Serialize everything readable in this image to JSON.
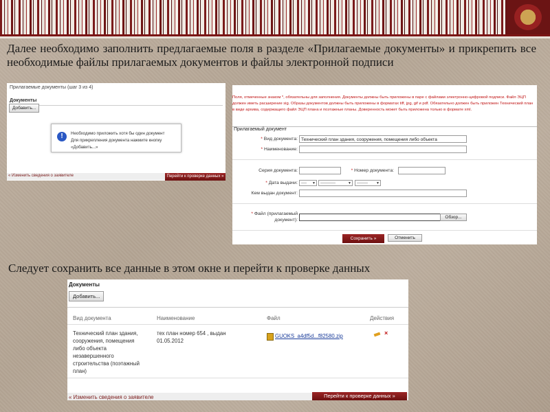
{
  "intro_text": "Далее необходимо заполнить предлагаемые поля в разделе «Прилагаемые документы» и прикрепить все необходимые файлы прилагаемых документов и файлы электронной подписи",
  "caption2": "Следует сохранить все данные в этом окне и перейти к проверке данных",
  "panel1": {
    "header": "Прилагаемые документы (шаг 3 из 4)",
    "section": "Документы",
    "add_button": "Добавить...",
    "dialog_line1": "Необходимо приложить хотя бы один документ",
    "dialog_line2": "Для прикрепления документа нажмите кнопку «Добавить...»",
    "prev_button": "« Изменить сведения о заявителе",
    "next_button": "Перейти к проверке данных »"
  },
  "panel2": {
    "note": "Поля, отмеченные знаком *, обязательны для заполнения. Документы должны быть приложены в паре с файлами электронно-цифровой подписи. Файл ЭЦП должен иметь расширение sig. Образы документов должны быть приложены в форматах tiff, jpg, gif и pdf. Обязательно должен быть приложен Технический план в виде архива, содержащего файл ЭЦП плана и поэтажные планы. Доверенность может быть приложена только в формате xml.",
    "section_title": "Прилагаемый документ",
    "doc_type_label": "Вид документа:",
    "doc_type_value": "Технический план здания, сооружения, помещения либо объекта",
    "name_label": "Наименование:",
    "series_label": "Серия документа:",
    "number_label": "Номер документа:",
    "issue_date_label": "Дата выдачи:",
    "day_value": "----",
    "month_value": "-----------",
    "year_value": "--------",
    "issued_by_label": "Кем выдан документ:",
    "file_label_1": "Файл (прилагаемый",
    "file_label_2": "документ):",
    "browse_button": "Обзор...",
    "save_button": "Сохранить »",
    "cancel_button": "Отменить"
  },
  "panel3": {
    "section": "Документы",
    "add_button": "Добавить...",
    "columns": [
      "Вид документа",
      "Наименование",
      "Файл",
      "Действия"
    ],
    "row": {
      "type": [
        "Технический план здания,",
        "сооружения, помещения",
        "либо объекта",
        "незавершенного",
        "строительства (поэтажный",
        "план)"
      ],
      "name": [
        "тех план номер 654 , выдан",
        "01.05.2012"
      ],
      "file": "GUOKS_a4df5d...f82580.zip"
    },
    "prev_button": "« Изменить сведения о заявителе",
    "next_button": "Перейти к проверке данных »"
  }
}
